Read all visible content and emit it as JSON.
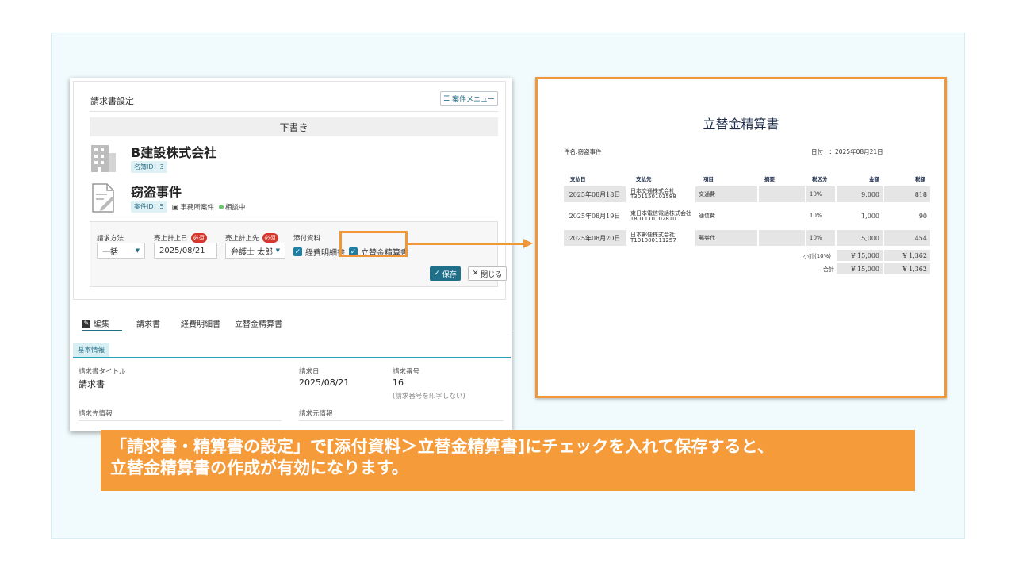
{
  "panel": {
    "title": "請求書設定",
    "case_menu_label": "案件メニュー",
    "status_bar": "下書き",
    "client": {
      "name": "B建設株式会社",
      "id_tag": "名簿ID：3"
    },
    "case": {
      "name": "窃盗事件",
      "id_tag": "案件ID：5",
      "office_case": "事務所案件",
      "status": "相談中"
    },
    "form": {
      "method_label": "請求方法",
      "method_value": "一括",
      "date_label": "売上計上日",
      "date_value": "2025/08/21",
      "required": "必須",
      "account_label": "売上計上先",
      "account_value": "弁護士 太郎",
      "attach_label": "添付資料",
      "attach_expense": "経費明細書",
      "attach_advance": "立替金精算書",
      "save": "保存",
      "close": "閉じる"
    },
    "tabs": [
      "編集",
      "請求書",
      "経費明細書",
      "立替金精算書"
    ],
    "section": "基本情報",
    "fields": {
      "title_label": "請求書タイトル",
      "title_value": "請求書",
      "date_label": "請求日",
      "date_value": "2025/08/21",
      "number_label": "請求番号",
      "number_value": "16",
      "number_note": "(請求番号を印字しない)",
      "to_label": "請求先情報",
      "from_label": "請求元情報"
    }
  },
  "document": {
    "title": "立替金精算書",
    "case_line": "件名:窃盗事件",
    "date_line": "日付　：2025年08月21日",
    "headers": [
      "支払日",
      "支払先",
      "項目",
      "摘要",
      "税区分",
      "金額",
      "税額"
    ],
    "rows": [
      {
        "date": "2025年08月18日",
        "payee1": "日本交通株式会社",
        "payee2": "T301150101588",
        "item": "交通費",
        "tax": "10%",
        "amount": "9,000",
        "taxamt": "818"
      },
      {
        "date": "2025年08月19日",
        "payee1": "東日本電信電話株式会社",
        "payee2": "T801110102810",
        "item": "通信費",
        "tax": "10%",
        "amount": "1,000",
        "taxamt": "90"
      },
      {
        "date": "2025年08月20日",
        "payee1": "日本郵便株式会社",
        "payee2": "T101000111257",
        "item": "郵券代",
        "tax": "10%",
        "amount": "5,000",
        "taxamt": "454"
      }
    ],
    "subtotal_label": "小計(10%)",
    "subtotal_amount": "¥ 15,000",
    "subtotal_tax": "¥ 1,362",
    "total_label": "合計",
    "total_amount": "¥ 15,000",
    "total_tax": "¥ 1,362"
  },
  "caption": {
    "line1": "「請求書・精算書の設定」で[添付資料＞立替金精算書]にチェックを入れて保存すると、",
    "line2": "立替金精算書の作成が有効になります。"
  },
  "colors": {
    "accent": "#f0973a",
    "teal": "#1f6f88",
    "caption_bg": "#f59b3a"
  }
}
